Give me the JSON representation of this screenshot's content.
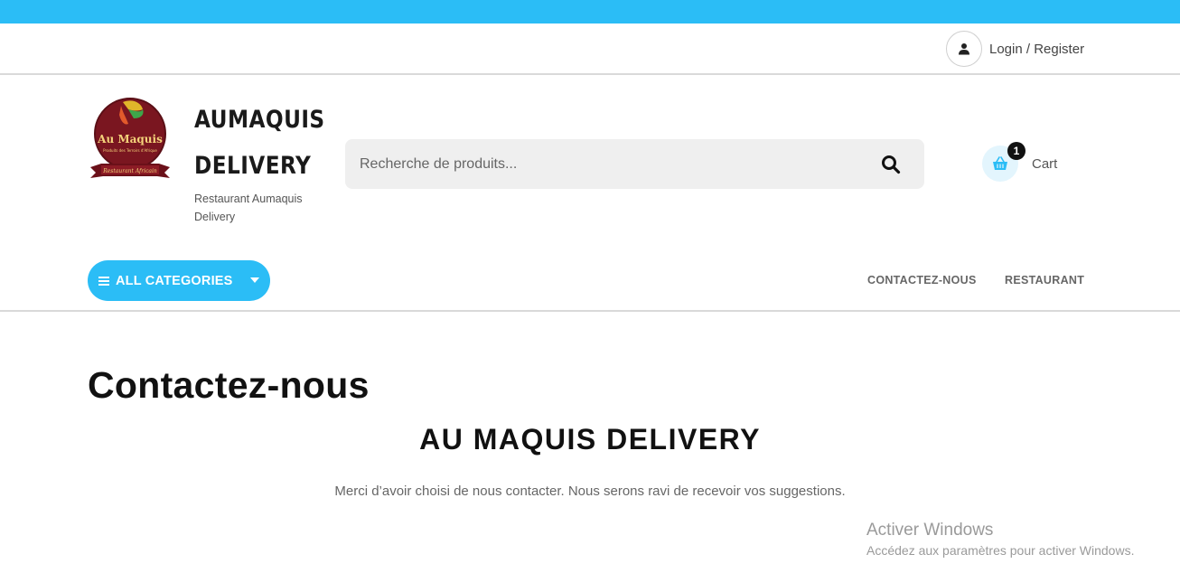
{
  "account": {
    "login_label": "Login / Register"
  },
  "brand": {
    "name_line1": "AUMAQUIS",
    "name_line2": "DELIVERY",
    "tagline": "Restaurant Aumaquis Delivery",
    "logo_text": "Au Maquis",
    "logo_subtext": "Produits des Terroirs d'Afrique",
    "logo_ribbon": "Restaurant Africain"
  },
  "search": {
    "placeholder": "Recherche de produits...",
    "icon": "search-icon"
  },
  "cart": {
    "count": "1",
    "label": "Cart",
    "icon": "basket-icon"
  },
  "nav": {
    "all_categories": "ALL CATEGORIES",
    "links": [
      "CONTACTEZ-NOUS",
      "RESTAURANT"
    ]
  },
  "content": {
    "page_title": "Contactez-nous",
    "section_title": "AU MAQUIS DELIVERY",
    "intro": "Merci d’avoir choisi de nous contacter. Nous serons ravi de recevoir vos suggestions."
  },
  "watermark": {
    "title": "Activer Windows",
    "subtitle": "Accédez aux paramètres pour activer Windows."
  },
  "colors": {
    "accent": "#2bbdf6",
    "logo_maroon": "#7a1620",
    "badge": "#111111"
  }
}
